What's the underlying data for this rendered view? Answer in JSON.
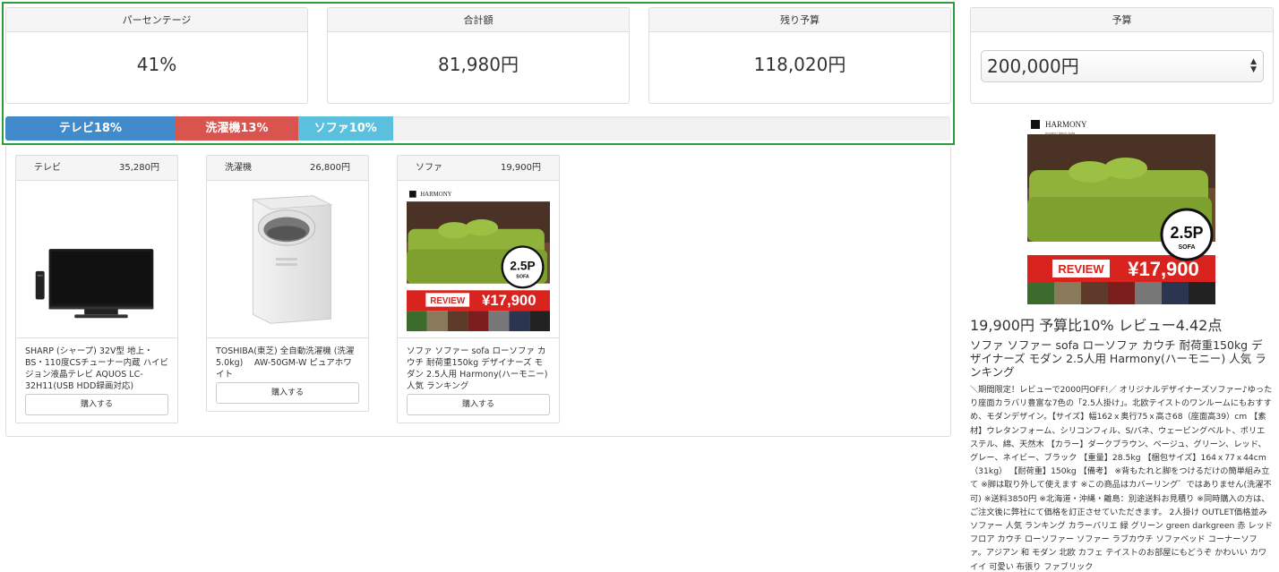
{
  "summary": {
    "percentage": {
      "label": "パーセンテージ",
      "value": "41%"
    },
    "total": {
      "label": "合計額",
      "value": "81,980円"
    },
    "remaining": {
      "label": "残り予算",
      "value": "118,020円"
    }
  },
  "budget": {
    "label": "予算",
    "value": "200,000円"
  },
  "progress": [
    {
      "label": "テレビ18%",
      "percent": 18,
      "color": "#428bca"
    },
    {
      "label": "洗濯機13%",
      "percent": 13,
      "color": "#d9534f"
    },
    {
      "label": "ソファ10%",
      "percent": 10,
      "color": "#5bc0de"
    }
  ],
  "products": [
    {
      "category": "テレビ",
      "price": "35,280円",
      "description": "SHARP (シャープ) 32V型 地上・BS・110度CSチューナー内蔵 ハイビジョン液晶テレビ AQUOS LC-32H11(USB HDD録画対応)",
      "button": "購入する"
    },
    {
      "category": "洗濯機",
      "price": "26,800円",
      "description": "TOSHIBA(東芝) 全自動洗濯機 (洗濯5.0kg)　 AW-50GM-W ピュアホワイト",
      "button": "購入する"
    },
    {
      "category": "ソファ",
      "price": "19,900円",
      "description": "ソファ ソファー sofa ローソファ カウチ 耐荷重150kg デザイナーズ モダン 2.5人用 Harmony(ハーモニー) 人気 ランキング",
      "button": "購入する"
    }
  ],
  "sofa_image": {
    "brand": "HARMONY",
    "brand_sub": "modern fabric sofa",
    "badge_main": "2.5P",
    "badge_sub": "SOFA",
    "review": "REVIEW",
    "price": "¥17,900"
  },
  "detail": {
    "title": "19,900円 予算比10% レビュー4.42点",
    "name": "ソファ ソファー sofa ローソファ カウチ 耐荷重150kg デザイナーズ モダン 2.5人用 Harmony(ハーモニー) 人気 ランキング",
    "description": "＼期間限定！レビューで2000円OFF!／ オリジナルデザイナーズソファー♪ゆったり座面カラバリ豊富な7色の「2.5人掛け」。北欧テイストのワンルームにもおすすめ、モダンデザイン。【サイズ】幅162ｘ奥行75ｘ高さ68（座面高39）cm 【素材】ウレタンフォーム、シリコンフィル、S/バネ、ウェービングベルト、ポリエステル、綿、天然木 【カラー】ダークブラウン、ベージュ、グリーン、レッド、グレー、ネイビー、ブラック 【重量】28.5kg 【梱包サイズ】164ｘ77ｘ44cm（31kg） 【耐荷重】150kg 【備考】 ※背もたれと脚をつけるだけの簡単組み立て ※脚は取り外して使えます ※この商品はカバーリング゛ではありません(洗濯不可) ※送料3850円 ※北海道・沖縄・離島：別途送料お見積り ※同時購入の方は、ご注文後に弊社にて価格を訂正させていただきます。 2人掛け OUTLET価格並み ソファー 人気 ランキング カラーバリエ 緑 グリーン green darkgreen 赤 レッド フロア カウチ ローソファー ソファー ラブカウチ ソファベッド コーナーソファ。アジアン 和 モダン 北欧 カフェ テイストのお部屋にもどうぞ かわいい カワイイ 可愛い 布張り ファブリック"
  }
}
